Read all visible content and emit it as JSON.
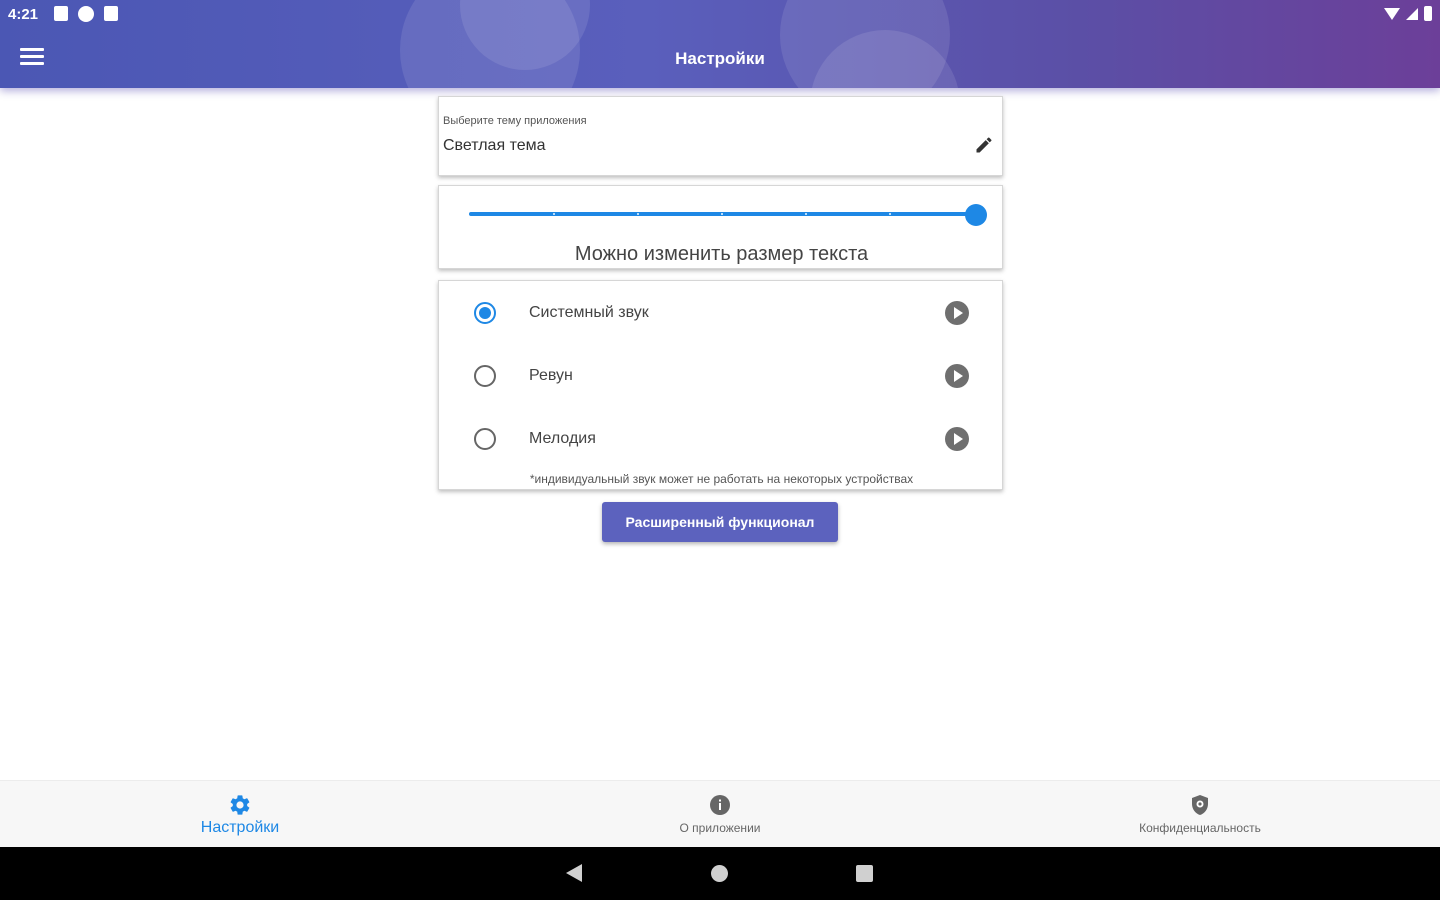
{
  "status_bar": {
    "time": "4:21"
  },
  "app_bar": {
    "title": "Настройки",
    "menu_icon": "menu-icon"
  },
  "theme": {
    "hint": "Выберите тему приложения",
    "value": "Светлая тема",
    "edit_icon": "pencil-icon"
  },
  "text_size": {
    "label": "Можно изменить размер текста",
    "level": 1.0
  },
  "sounds": {
    "options": [
      {
        "label": "Системный звук",
        "selected": true
      },
      {
        "label": "Ревун",
        "selected": false
      },
      {
        "label": "Мелодия",
        "selected": false
      }
    ],
    "note": "*индивидуальный звук может не работать на некоторых устройствах"
  },
  "extended_button": {
    "label": "Расширенный функционал"
  },
  "bottom_nav": {
    "items": [
      {
        "label": "Настройки",
        "icon": "gear-icon",
        "active": true
      },
      {
        "label": "О приложении",
        "icon": "info-icon",
        "active": false
      },
      {
        "label": "Конфиденциальность",
        "icon": "shield-icon",
        "active": false
      }
    ]
  },
  "colors": {
    "accent": "#1e88e5",
    "primary": "#5c62be",
    "gradient_end": "#6c3f99"
  }
}
